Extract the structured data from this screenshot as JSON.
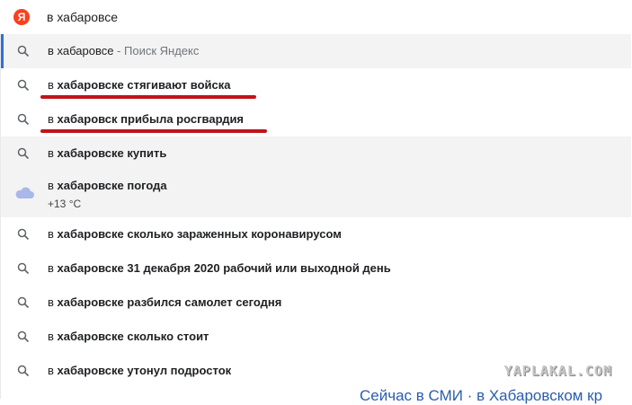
{
  "search": {
    "logo_letter": "Я",
    "query": "в хабаровсе"
  },
  "suggestions": [
    {
      "prefix": "в хабаровсе",
      "bold": "",
      "suffix": " - Поиск Яндекс",
      "icon": "search-icon"
    },
    {
      "prefix": "в ",
      "bold": "хабаровске стягивают войска",
      "suffix": "",
      "icon": "search-icon"
    },
    {
      "prefix": "в ",
      "bold": "хабаровск прибыла росгвардия",
      "suffix": "",
      "icon": "search-icon"
    },
    {
      "prefix": "в ",
      "bold": "хабаровске купить",
      "suffix": "",
      "icon": "search-icon"
    },
    {
      "prefix": "в ",
      "bold": "хабаровске погода",
      "suffix": "",
      "icon": "cloud-icon",
      "sub": "+13 °C"
    },
    {
      "prefix": "в ",
      "bold": "хабаровске сколько зараженных коронавирусом",
      "suffix": "",
      "icon": "search-icon"
    },
    {
      "prefix": "в ",
      "bold": "хабаровске 31 декабря 2020 рабочий или выходной день",
      "suffix": "",
      "icon": "search-icon"
    },
    {
      "prefix": "в ",
      "bold": "хабаровске разбился самолет сегодня",
      "suffix": "",
      "icon": "search-icon"
    },
    {
      "prefix": "в ",
      "bold": "хабаровске сколько стоит",
      "suffix": "",
      "icon": "search-icon"
    },
    {
      "prefix": "в ",
      "bold": "хабаровске утонул подросток",
      "suffix": "",
      "icon": "search-icon"
    }
  ],
  "watermark": "YAPLAKAL.COM",
  "background_peek": "Сейчас в СМИ · в Хабаровском кр",
  "colors": {
    "brand": "#fc3f1d",
    "accent": "#2f6fdb",
    "underline": "#c0141a",
    "highlight_row": "#f3f3f3"
  }
}
